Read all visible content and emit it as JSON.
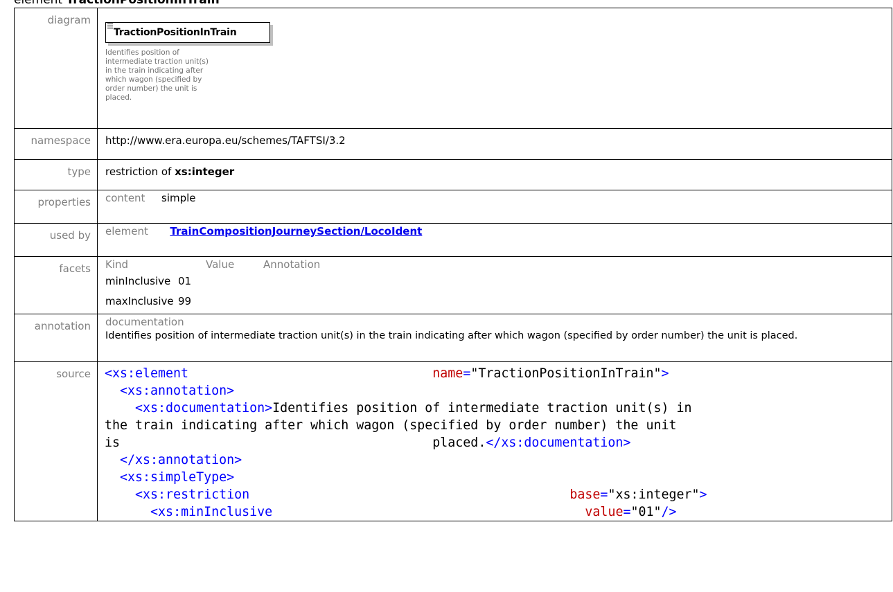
{
  "heading": {
    "prefix": "element",
    "name": "TractionPositionInTrain"
  },
  "labels": {
    "diagram": "diagram",
    "namespace": "namespace",
    "type": "type",
    "properties": "properties",
    "used_by": "used by",
    "facets": "facets",
    "annotation": "annotation",
    "source": "source"
  },
  "diagram": {
    "element_name": "TractionPositionInTrain",
    "description": "Identifies position of intermediate traction unit(s) in the train indicating after which wagon (specified by order number) the unit is placed."
  },
  "namespace": "http://www.era.europa.eu/schemes/TAFTSI/3.2",
  "type": {
    "prefix": "restriction of",
    "base": "xs:integer"
  },
  "properties": {
    "key": "content",
    "value": "simple"
  },
  "used_by": {
    "kind": "element",
    "link": "TrainCompositionJourneySection/LocoIdent"
  },
  "facets": {
    "headers": [
      "Kind",
      "Value",
      "Annotation"
    ],
    "rows": [
      {
        "kind": "minInclusive",
        "value": "01"
      },
      {
        "kind": "maxInclusive",
        "value": "99"
      }
    ]
  },
  "annotation": {
    "head": "documentation",
    "text": "Identifies position of intermediate traction unit(s) in the train indicating after which wagon (specified by order number) the unit is placed."
  },
  "source": {
    "el_open": "<xs:element",
    "name_attr": "name",
    "name_val": "\"TractionPositionInTrain\"",
    "ann_open": "<xs:annotation>",
    "doc_open": "<xs:documentation>",
    "doc_text_1": "Identifies position of intermediate traction unit(s) in",
    "doc_text_2": "the train indicating after which wagon (specified by order number) the unit",
    "doc_text_3a": "is",
    "doc_text_3b": "placed.",
    "doc_close": "</xs:documentation>",
    "ann_close": "</xs:annotation>",
    "st_open": "<xs:simpleType>",
    "res_open": "<xs:restriction",
    "base_attr": "base",
    "base_val": "\"xs:integer\"",
    "min_open": "<xs:minInclusive",
    "value_attr": "value",
    "min_val": "\"01\""
  }
}
